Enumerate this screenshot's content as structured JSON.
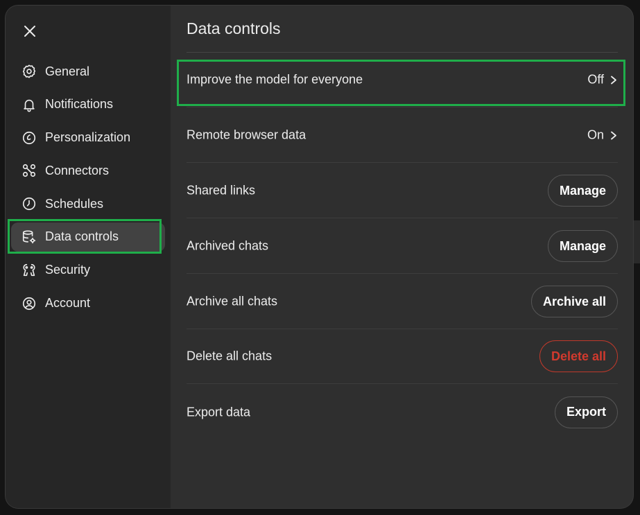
{
  "sidebar": {
    "items": [
      {
        "label": "General",
        "icon": "gear-icon"
      },
      {
        "label": "Notifications",
        "icon": "bell-icon"
      },
      {
        "label": "Personalization",
        "icon": "personalization-icon"
      },
      {
        "label": "Connectors",
        "icon": "connectors-icon"
      },
      {
        "label": "Schedules",
        "icon": "clock-icon"
      },
      {
        "label": "Data controls",
        "icon": "database-gear-icon",
        "active": true
      },
      {
        "label": "Security",
        "icon": "security-icon"
      },
      {
        "label": "Account",
        "icon": "user-circle-icon"
      }
    ]
  },
  "main": {
    "title": "Data controls",
    "rows": [
      {
        "label": "Improve the model for everyone",
        "value": "Off"
      },
      {
        "label": "Remote browser data",
        "value": "On"
      },
      {
        "label": "Shared links",
        "button": "Manage"
      },
      {
        "label": "Archived chats",
        "button": "Manage"
      },
      {
        "label": "Archive all chats",
        "button": "Archive all"
      },
      {
        "label": "Delete all chats",
        "button": "Delete all"
      },
      {
        "label": "Export data",
        "button": "Export"
      }
    ]
  },
  "colors": {
    "highlight": "#1fae4a",
    "danger": "#d23a2e",
    "modal_bg": "#2f2f2f",
    "sidebar_bg": "#262626"
  }
}
